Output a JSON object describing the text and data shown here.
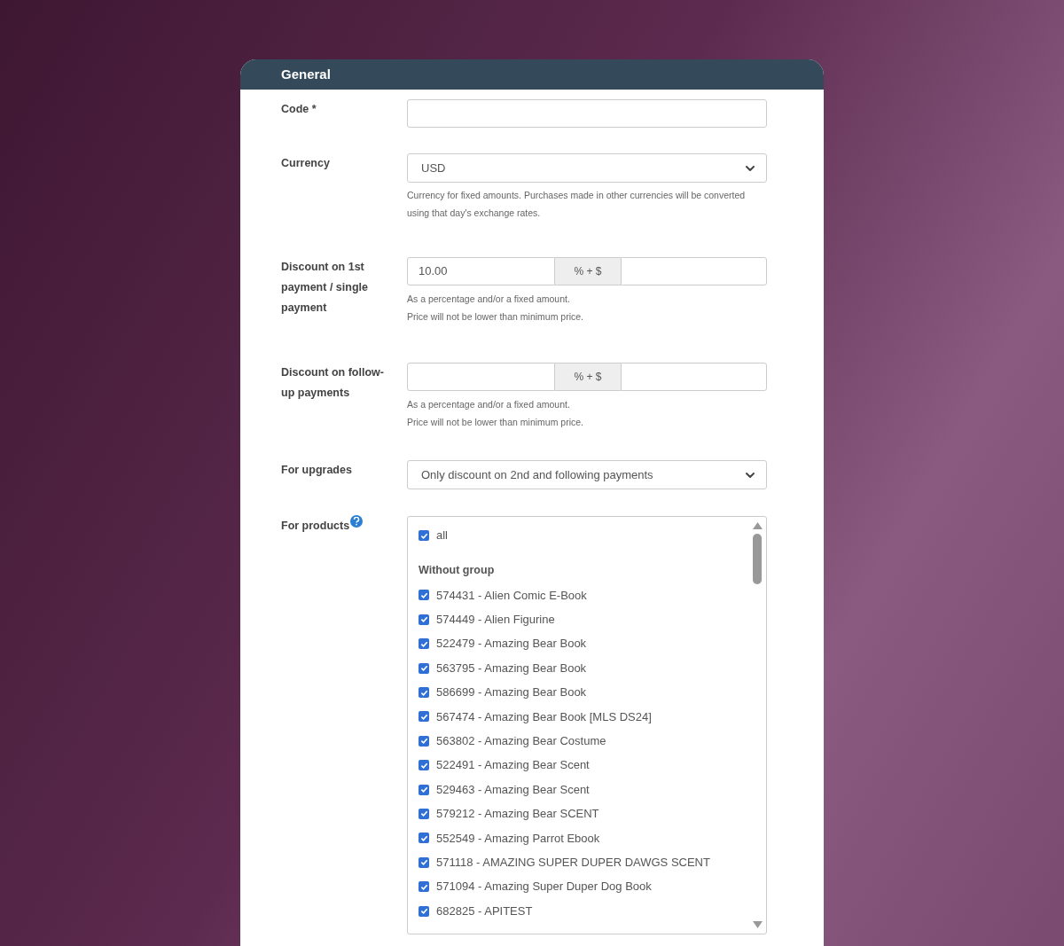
{
  "section": {
    "title": "General"
  },
  "code": {
    "label": "Code *"
  },
  "currency": {
    "label": "Currency",
    "value": "USD",
    "help": "Currency for fixed amounts. Purchases made in other currencies will be converted using that day's exchange rates."
  },
  "discounts": [
    {
      "label": "Discount on 1st payment / single payment",
      "percent": "10.00",
      "addon": "% + $",
      "help": [
        "As a percentage and/or a fixed amount.",
        "Price will not be lower than minimum price."
      ]
    },
    {
      "label": "Discount on follow-up payments",
      "addon": "% + $",
      "help": [
        "As a percentage and/or a fixed amount.",
        "Price will not be lower than minimum price."
      ]
    }
  ],
  "upgrades": {
    "label": "For upgrades",
    "value": "Only discount on 2nd and following payments"
  },
  "products": {
    "label": "For products",
    "all": {
      "label": "all",
      "checked": true
    },
    "group": "Without group",
    "items": [
      {
        "label": "574431 - Alien Comic E-Book",
        "checked": true
      },
      {
        "label": "574449 - Alien Figurine",
        "checked": true
      },
      {
        "label": "522479 - Amazing Bear Book",
        "checked": true
      },
      {
        "label": "563795 - Amazing Bear Book",
        "checked": true
      },
      {
        "label": "586699 - Amazing Bear Book",
        "checked": true
      },
      {
        "label": "567474 - Amazing Bear Book [MLS DS24]",
        "checked": true
      },
      {
        "label": "563802 - Amazing Bear Costume",
        "checked": true
      },
      {
        "label": "522491 - Amazing Bear Scent",
        "checked": true
      },
      {
        "label": "529463 - Amazing Bear Scent",
        "checked": true
      },
      {
        "label": "579212 - Amazing Bear SCENT",
        "checked": true
      },
      {
        "label": "552549 - Amazing Parrot Ebook",
        "checked": true
      },
      {
        "label": "571118 - AMAZING SUPER DUPER DAWGS SCENT",
        "checked": true
      },
      {
        "label": "571094 - Amazing Super Duper Dog Book",
        "checked": true
      },
      {
        "label": "682825 - APITEST",
        "checked": true
      }
    ]
  }
}
